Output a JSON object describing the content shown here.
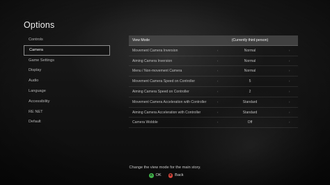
{
  "title": "Options",
  "menu": [
    {
      "label": "Controls",
      "active": false
    },
    {
      "label": "Camera",
      "active": true
    },
    {
      "label": "Game Settings",
      "active": false
    },
    {
      "label": "Display",
      "active": false
    },
    {
      "label": "Audio",
      "active": false
    },
    {
      "label": "Language",
      "active": false
    },
    {
      "label": "Accessibility",
      "active": false
    },
    {
      "label": "RE NET",
      "active": false
    },
    {
      "label": "Default",
      "active": false
    }
  ],
  "settings": [
    {
      "label": "View Mode",
      "value": "(Currently third person)",
      "active": true
    },
    {
      "label": "Movement Camera Inversion",
      "value": "Normal",
      "active": false
    },
    {
      "label": "Aiming Camera Inversion",
      "value": "Normal",
      "active": false
    },
    {
      "label": "Menu / Non-movement Camera",
      "value": "Normal",
      "active": false
    },
    {
      "label": "Movement Camera Speed on Controller",
      "value": "5",
      "active": false
    },
    {
      "label": "Aiming Camera Speed on Controller",
      "value": "2",
      "active": false
    },
    {
      "label": "Movement Camera Acceleration with Controller",
      "value": "Standard",
      "active": false
    },
    {
      "label": "Aiming Camera Acceleration with Controller",
      "value": "Standard",
      "active": false
    },
    {
      "label": "Camera Wobble",
      "value": "Off",
      "active": false
    }
  ],
  "arrows": {
    "left": "‹",
    "right": "›"
  },
  "description": "Change the view mode for the main story.",
  "footer": {
    "ok": {
      "glyph": "A",
      "label": "OK",
      "color": "#3fae49"
    },
    "back": {
      "glyph": "B",
      "label": "Back",
      "color": "#d8453b"
    }
  }
}
